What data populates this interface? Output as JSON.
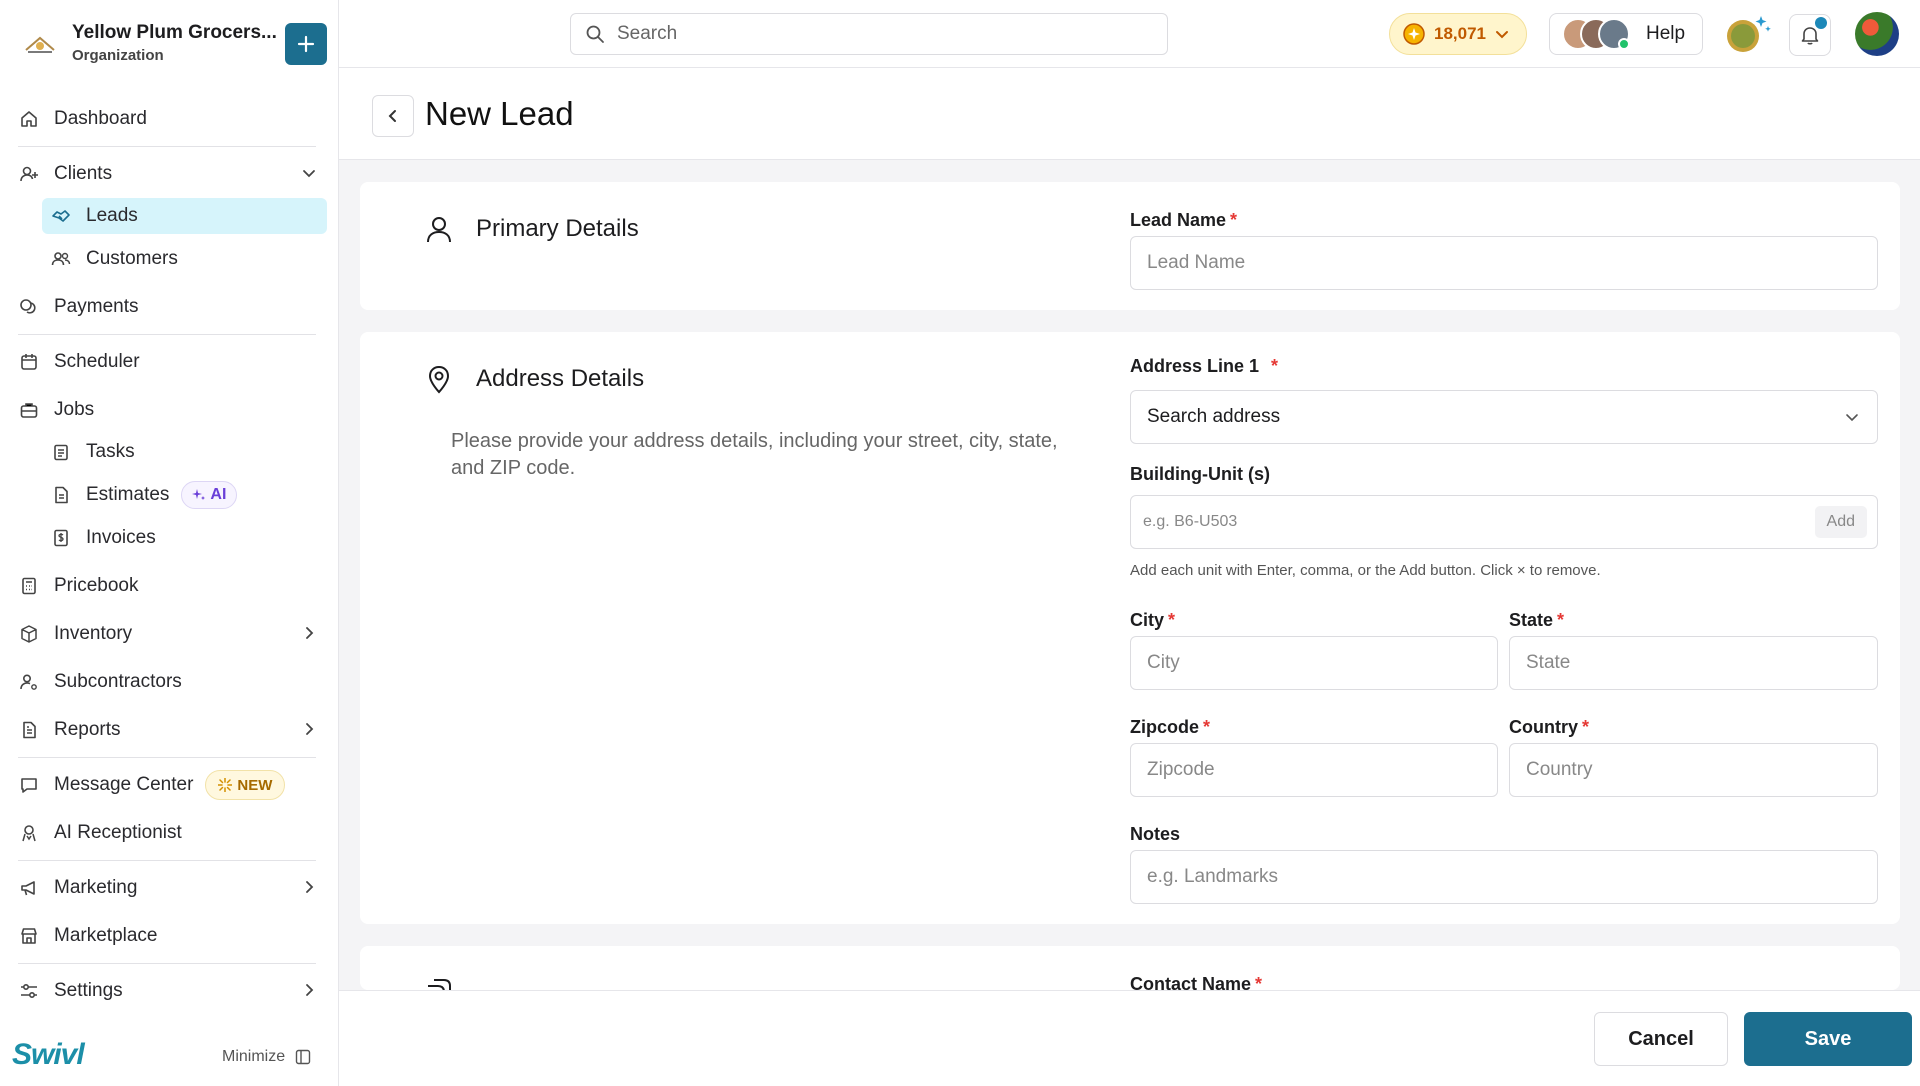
{
  "organization": {
    "name": "Yellow Plum Grocers...",
    "subtitle": "Organization"
  },
  "sidebar": {
    "dashboard": "Dashboard",
    "clients": "Clients",
    "leads": "Leads",
    "customers": "Customers",
    "payments": "Payments",
    "scheduler": "Scheduler",
    "jobs": "Jobs",
    "tasks": "Tasks",
    "estimates": "Estimates",
    "estimates_badge": "AI",
    "invoices": "Invoices",
    "pricebook": "Pricebook",
    "inventory": "Inventory",
    "subcontractors": "Subcontractors",
    "reports": "Reports",
    "message_center": "Message Center",
    "message_center_badge": "NEW",
    "ai_receptionist": "AI Receptionist",
    "marketing": "Marketing",
    "marketplace": "Marketplace",
    "settings": "Settings",
    "brand": "Swivl",
    "minimize": "Minimize"
  },
  "topbar": {
    "search_placeholder": "Search",
    "credits": "18,071",
    "help": "Help"
  },
  "page": {
    "title": "New Lead"
  },
  "primary": {
    "heading": "Primary Details",
    "lead_name_label": "Lead Name",
    "lead_name_placeholder": "Lead Name",
    "required_mark": "*"
  },
  "address": {
    "heading": "Address Details",
    "description": "Please provide your address details, including your street, city, state, and ZIP code.",
    "line1_label": "Address Line 1",
    "line1_value": "Search address",
    "unit_label": "Building-Unit (s)",
    "unit_placeholder": "e.g. B6-U503",
    "unit_add": "Add",
    "unit_hint": "Add each unit with Enter, comma, or the Add button. Click × to remove.",
    "city_label": "City",
    "city_placeholder": "City",
    "state_label": "State",
    "state_placeholder": "State",
    "zip_label": "Zipcode",
    "zip_placeholder": "Zipcode",
    "country_label": "Country",
    "country_placeholder": "Country",
    "notes_label": "Notes",
    "notes_placeholder": "e.g. Landmarks"
  },
  "contact": {
    "name_label": "Contact Name"
  },
  "actions": {
    "cancel": "Cancel",
    "save": "Save"
  },
  "colors": {
    "accent": "#1c6e8f",
    "active_bg": "#d6f4fb",
    "required": "#e53935"
  }
}
